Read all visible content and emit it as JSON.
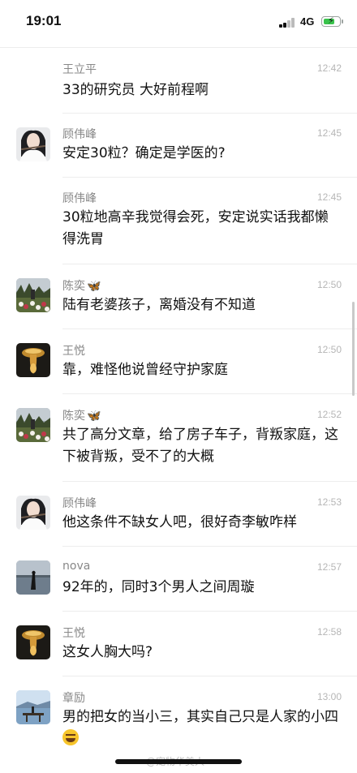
{
  "status_bar": {
    "time": "19:01",
    "network": "4G"
  },
  "messages": [
    {
      "name": "王立平",
      "time": "12:42",
      "text": "33的研究员 大好前程啊",
      "avatar": "none"
    },
    {
      "name": "顾伟峰",
      "time": "12:45",
      "text": "安定30粒？确定是学医的?",
      "avatar": "woman-with-flute"
    },
    {
      "name": "顾伟峰",
      "time": "12:45",
      "text": "30粒地高辛我觉得会死，安定说实话我都懒得洗胃",
      "avatar": "none"
    },
    {
      "name": "陈奕",
      "name_badge": "🦋",
      "time": "12:50",
      "text": "陆有老婆孩子，离婚没有不知道",
      "avatar": "tulip-field"
    },
    {
      "name": "王悦",
      "time": "12:50",
      "text": "靠，难怪他说曾经守护家庭",
      "avatar": "golden-drop"
    },
    {
      "name": "陈奕",
      "name_badge": "🦋",
      "time": "12:52",
      "text": "共了高分文章，给了房子车子，背叛家庭，这下被背叛，受不了的大概",
      "avatar": "tulip-field"
    },
    {
      "name": "顾伟峰",
      "time": "12:53",
      "text": "他这条件不缺女人吧，很好奇李敏咋样",
      "avatar": "woman-with-flute"
    },
    {
      "name": "nova",
      "time": "12:57",
      "text": "92年的，同时3个男人之间周璇",
      "avatar": "lake-figure"
    },
    {
      "name": "王悦",
      "time": "12:58",
      "text": "这女人胸大吗?",
      "avatar": "golden-drop"
    },
    {
      "name": "章励",
      "time": "13:00",
      "text": "男的把女的当小三，其实自己只是人家的小四",
      "text_emoji": "😂",
      "avatar": "pier-lake"
    }
  ],
  "watermark": "@宠物华美人",
  "colors": {
    "name": "#888888",
    "timestamp": "#b6b6b6",
    "text": "#111111",
    "divider": "#ededed",
    "battery_green": "#39c24b"
  }
}
